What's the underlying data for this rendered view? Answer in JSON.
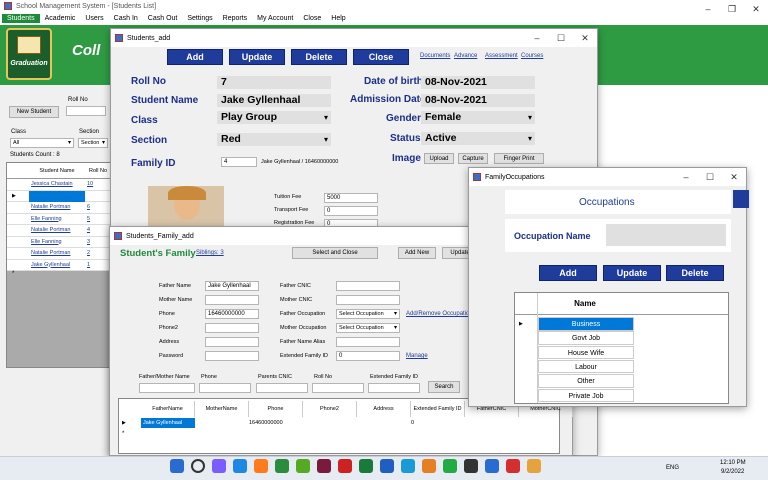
{
  "app": {
    "title": "School Management System - [Students List]",
    "logo_text": "Graduation",
    "college": "Coll"
  },
  "menu": [
    "Students",
    "Academic",
    "Users",
    "Cash In",
    "Cash Out",
    "Settings",
    "Reports",
    "My Account",
    "Close",
    "Help"
  ],
  "list": {
    "new_student": "New Student",
    "roll_no": "Roll No",
    "class": "Class",
    "class_value": "All",
    "section": "Section",
    "section_value": "Section",
    "count": "Students Count : 8",
    "col_name": "Student Name",
    "col_roll": "Roll No",
    "rows": [
      {
        "name": "Jessica Chastain",
        "roll": "10"
      },
      {
        "name": "",
        "roll": ""
      },
      {
        "name": "Natalie Portman",
        "roll": "6"
      },
      {
        "name": "Elle Fanning",
        "roll": "5"
      },
      {
        "name": "Natalie Portman",
        "roll": "4"
      },
      {
        "name": "Elle Fanning",
        "roll": "3"
      },
      {
        "name": "Natalie Portman",
        "roll": "2"
      },
      {
        "name": "Jake Gyllenhaal",
        "roll": "1"
      }
    ]
  },
  "sadd": {
    "title": "Students_add",
    "add": "Add",
    "update": "Update",
    "delete": "Delete",
    "close": "Close",
    "documents": "Documents",
    "advance": "Advance",
    "assessment": "Assessment",
    "courses": "Courses",
    "roll_label": "Roll No",
    "roll": "7",
    "name_label": "Student Name",
    "name": "Jake Gyllenhaal",
    "class_label": "Class",
    "class": "Play Group",
    "section_label": "Section",
    "section": "Red",
    "family_label": "Family ID",
    "family_id": "4",
    "family_text": "Jake Gyllenhaal / 16460000000",
    "dob_label": "Date of birth",
    "dob": "08-Nov-2021",
    "adm_label": "Admission Date",
    "adm": "08-Nov-2021",
    "gender_label": "Gender",
    "gender": "Female",
    "status_label": "Status",
    "status": "Active",
    "image_label": "Image",
    "upload": "Upload",
    "capture": "Capture",
    "finger": "Finger Print",
    "tuition_label": "Tuition Fee",
    "tuition": "5000",
    "transport_label": "Transport Fee",
    "transport": "0",
    "reg_label": "Registration Fee",
    "reg": "0"
  },
  "fam": {
    "title": "Students_Family_add",
    "header": "Student's Family",
    "siblings": "Siblings: 3",
    "select_close": "Select and Close",
    "add_new": "Add New",
    "update": "Update",
    "father_name_label": "Father Name",
    "father_name": "Jake Gyllenhaal",
    "mother_name_label": "Mother Name",
    "phone_label": "Phone",
    "phone": "16460000000",
    "phone2_label": "Phone2",
    "address_label": "Address",
    "password_label": "Password",
    "father_cnic_label": "Father CNIC",
    "mother_cnic_label": "Mother CNIC",
    "father_occ_label": "Father Occupation",
    "father_occ": "Select Occupation",
    "mother_occ_label": "Mother Occupation",
    "mother_occ": "Select Occupation",
    "alias_label": "Father Name Alias",
    "ext_label": "Extended Family ID",
    "ext": "0",
    "add_remove": "Add/Remove Occupation",
    "manage": "Manage",
    "s_fm": "Father/Mother Name",
    "s_phone": "Phone",
    "s_cnic": "Parents CNIC",
    "s_roll": "Roll No",
    "s_ext": "Extended Family ID",
    "search": "Search",
    "cols": [
      "FatherName",
      "MotherName",
      "Phone",
      "Phone2",
      "Address",
      "Extended Family ID",
      "FatherCNIC",
      "MotherCNIC"
    ],
    "row": {
      "father": "Jake Gyllenhaal",
      "phone": "16460000000",
      "ext": "0"
    }
  },
  "occ": {
    "title": "FamilyOccupations",
    "header": "Occupations",
    "name_label": "Occupation Name",
    "add": "Add",
    "update": "Update",
    "delete": "Delete",
    "col": "Name",
    "rows": [
      "Business",
      "Govt Job",
      "House Wife",
      "Labour",
      "Other",
      "Private Job"
    ]
  },
  "taskbar": {
    "lang": "ENG",
    "time": "12:10 PM",
    "date": "9/2/2022"
  },
  "colors": {
    "accent": "#1f3c9c",
    "green": "#1e8a3c",
    "select": "#0078d7"
  }
}
